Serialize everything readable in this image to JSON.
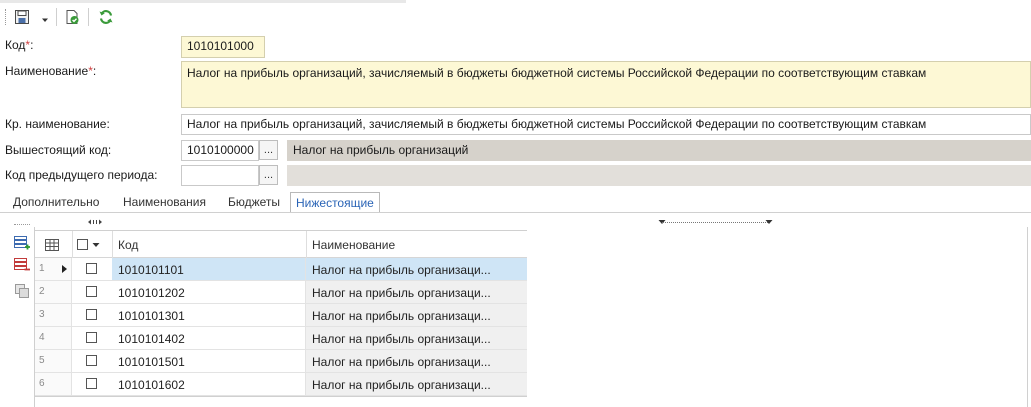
{
  "toolbar": {
    "icons": [
      "save-icon",
      "dropdown-arrow-icon",
      "check-document-icon",
      "refresh-icon"
    ]
  },
  "form": {
    "code_label": "Код",
    "code_required": "*",
    "code_colon": ":",
    "code_value": "1010101000",
    "name_label": "Наименование",
    "name_required": "*",
    "name_colon": ":",
    "name_value": "Налог на прибыль организаций, зачисляемый в бюджеты бюджетной системы Российской Федерации по соответствующим ставкам",
    "short_name_label": "Кр. наименование:",
    "short_name_value": "Налог на прибыль организаций, зачисляемый в бюджеты бюджетной системы Российской Федерации по соответствующим ставкам",
    "parent_code_label": "Вышестоящий код:",
    "parent_code_value": "1010100000",
    "parent_code_name": "Налог на прибыль организаций",
    "prev_code_label": "Код предыдущего периода:",
    "prev_code_value": "",
    "prev_code_name": "",
    "ellipsis": "..."
  },
  "tabs": [
    {
      "label": "Дополнительно",
      "active": false
    },
    {
      "label": "Наименования",
      "active": false
    },
    {
      "label": "Бюджеты",
      "active": false
    },
    {
      "label": "Нижестоящие",
      "active": true
    }
  ],
  "grid": {
    "columns": {
      "code": "Код",
      "name": "Наименование"
    },
    "rows": [
      {
        "num": "1",
        "code": "1010101101",
        "name": "Налог на прибыль организаци...",
        "selected": true
      },
      {
        "num": "2",
        "code": "1010101202",
        "name": "Налог на прибыль организаци...",
        "selected": false
      },
      {
        "num": "3",
        "code": "1010101301",
        "name": "Налог на прибыль организаци...",
        "selected": false
      },
      {
        "num": "4",
        "code": "1010101402",
        "name": "Налог на прибыль организаци...",
        "selected": false
      },
      {
        "num": "5",
        "code": "1010101501",
        "name": "Налог на прибыль организаци...",
        "selected": false
      },
      {
        "num": "6",
        "code": "1010101602",
        "name": "Налог на прибыль организаци...",
        "selected": false
      }
    ]
  },
  "colors": {
    "required": "#d04040",
    "active_tab": "#2a64b6",
    "selected_row": "#cfe5f6",
    "yellow_field": "#fdf8d5",
    "gray_field": "#d6d2cb",
    "refresh_green": "#3a9a3a"
  }
}
